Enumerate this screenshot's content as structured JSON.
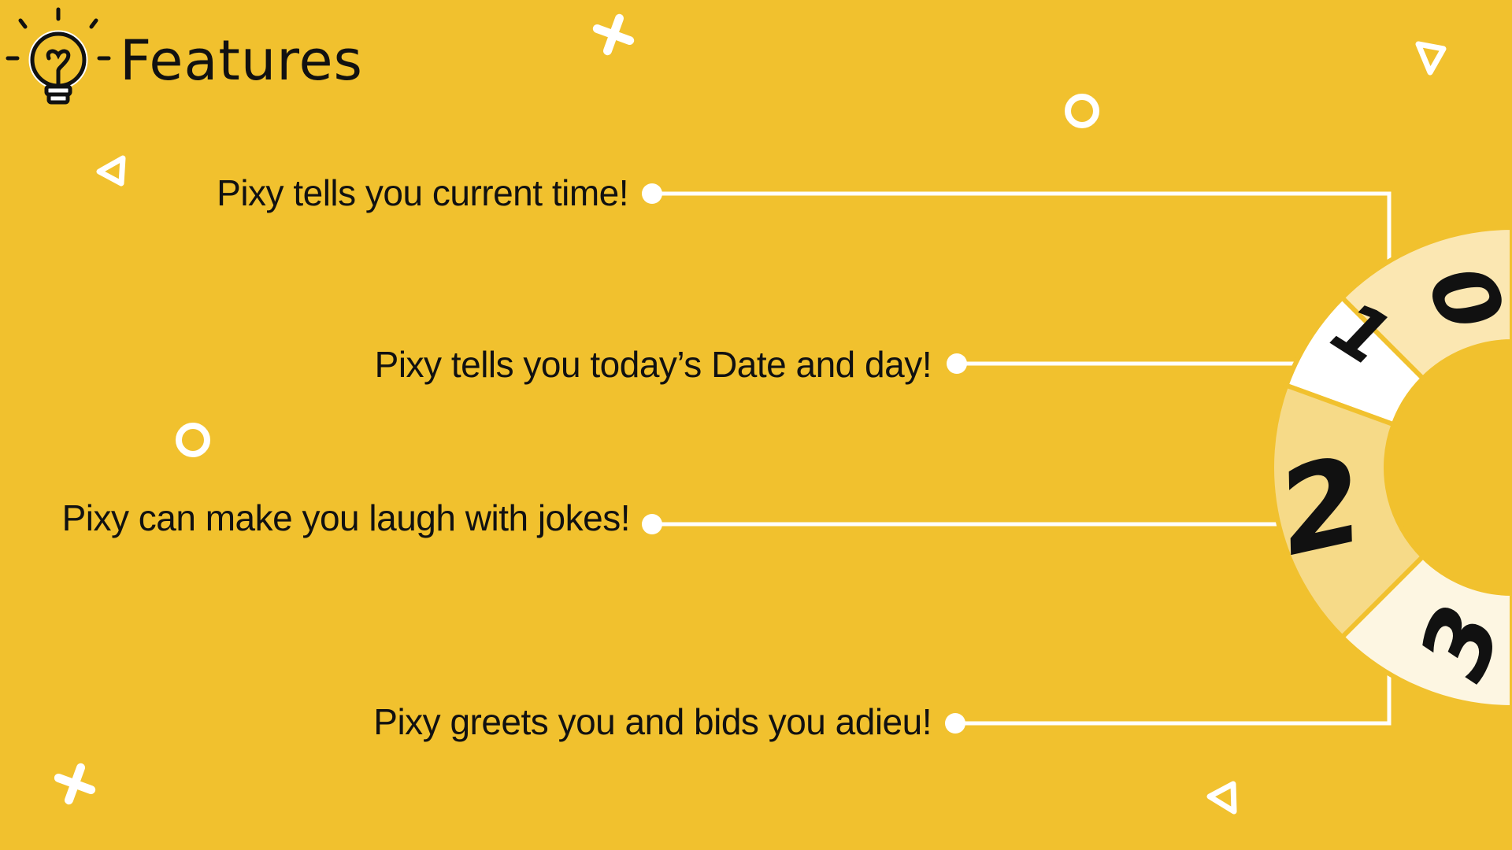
{
  "slide": {
    "title": "Features",
    "background_color": "#F1C12E",
    "icon": "lightbulb-icon"
  },
  "features": [
    {
      "number": "0",
      "text": "Pixy tells you current time!",
      "segment_color": "#FBE7B2"
    },
    {
      "number": "1",
      "text": "Pixy tells you today’s Date and day!",
      "segment_color": "#FFFFFF"
    },
    {
      "number": "2",
      "text": "Pixy can make you laugh with jokes!",
      "segment_color": "#F6DA88"
    },
    {
      "number": "3",
      "text": "Pixy greets you and bids you adieu!",
      "segment_color": "#FDF6E2"
    }
  ],
  "decorations": [
    "cross-icon",
    "circle-icon",
    "triangle-icon"
  ]
}
